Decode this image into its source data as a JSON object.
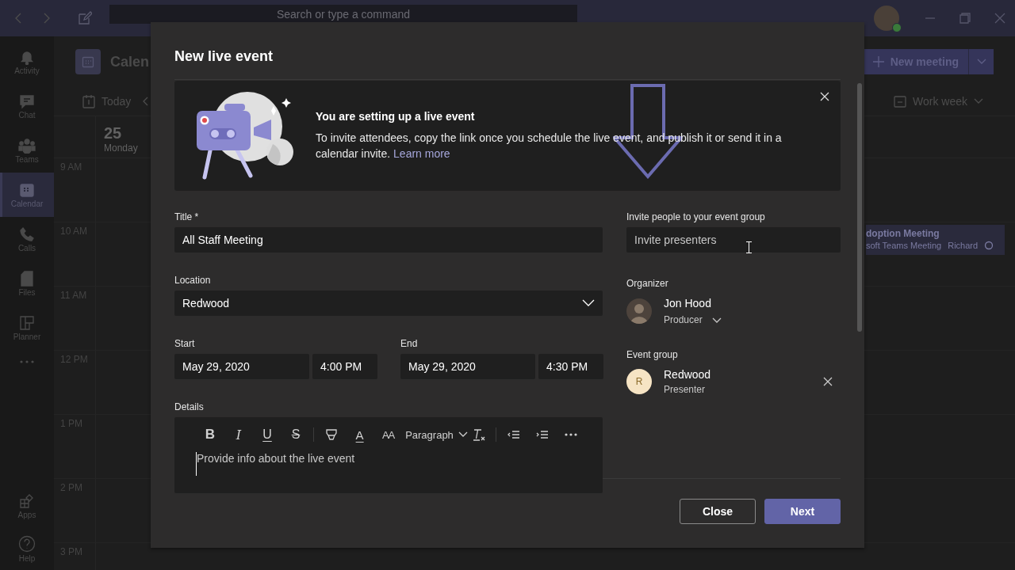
{
  "title_bar": {
    "search_placeholder": "Search or type a command"
  },
  "app_bar": {
    "items": [
      {
        "label": "Activity",
        "selected": false
      },
      {
        "label": "Chat",
        "selected": false
      },
      {
        "label": "Teams",
        "selected": false
      },
      {
        "label": "Calendar",
        "selected": true
      },
      {
        "label": "Calls",
        "selected": false
      },
      {
        "label": "Files",
        "selected": false
      },
      {
        "label": "Planner",
        "selected": false
      }
    ],
    "bottom": [
      {
        "label": "Apps"
      },
      {
        "label": "Help"
      }
    ]
  },
  "calendar": {
    "title": "Calen",
    "today": "Today",
    "new_meeting": "New meeting",
    "view": "Work week",
    "day": {
      "date": "25",
      "weekday": "Monday"
    },
    "hours": [
      "9 AM",
      "10 AM",
      "11 AM",
      "12 PM",
      "1 PM",
      "2 PM",
      "3 PM"
    ],
    "event": {
      "title": "doption Meeting",
      "subtitle": "soft Teams Meeting",
      "organizer": "Richard"
    }
  },
  "dialog": {
    "title": "New live event",
    "banner": {
      "heading": "You are setting up a live event",
      "text": "To invite attendees, copy the link once you schedule the live event, and publish it or send it in a calendar invite.",
      "link": "Learn more"
    },
    "title_field": {
      "label": "Title *",
      "value": "All Staff Meeting"
    },
    "location": {
      "label": "Location",
      "value": "Redwood"
    },
    "start": {
      "label": "Start",
      "date": "May 29, 2020",
      "time": "4:00 PM"
    },
    "end": {
      "label": "End",
      "date": "May 29, 2020",
      "time": "4:30 PM"
    },
    "details": {
      "label": "Details",
      "placeholder": "Provide info about the live event",
      "toolbar": [
        {
          "kind": "bold",
          "glyph": "B"
        },
        {
          "kind": "italic",
          "glyph": "I"
        },
        {
          "kind": "underline",
          "glyph": "U"
        },
        {
          "kind": "strike",
          "glyph": "S"
        },
        {
          "kind": "highlight"
        },
        {
          "kind": "font-color",
          "glyph": "A"
        },
        {
          "kind": "font-size",
          "glyph": "AA"
        },
        {
          "kind": "paragraph",
          "glyph": "Paragraph"
        },
        {
          "kind": "clear-format"
        },
        {
          "kind": "outdent"
        },
        {
          "kind": "indent"
        },
        {
          "kind": "more"
        }
      ]
    },
    "invite": {
      "label": "Invite people to your event group",
      "placeholder": "Invite presenters"
    },
    "organizer": {
      "label": "Organizer",
      "name": "Jon Hood",
      "role": "Producer"
    },
    "event_group": {
      "label": "Event group",
      "members": [
        {
          "initial": "R",
          "name": "Redwood",
          "role": "Presenter"
        }
      ]
    },
    "buttons": [
      {
        "label": "Close",
        "kind": "secondary"
      },
      {
        "label": "Next",
        "kind": "primary"
      }
    ]
  }
}
